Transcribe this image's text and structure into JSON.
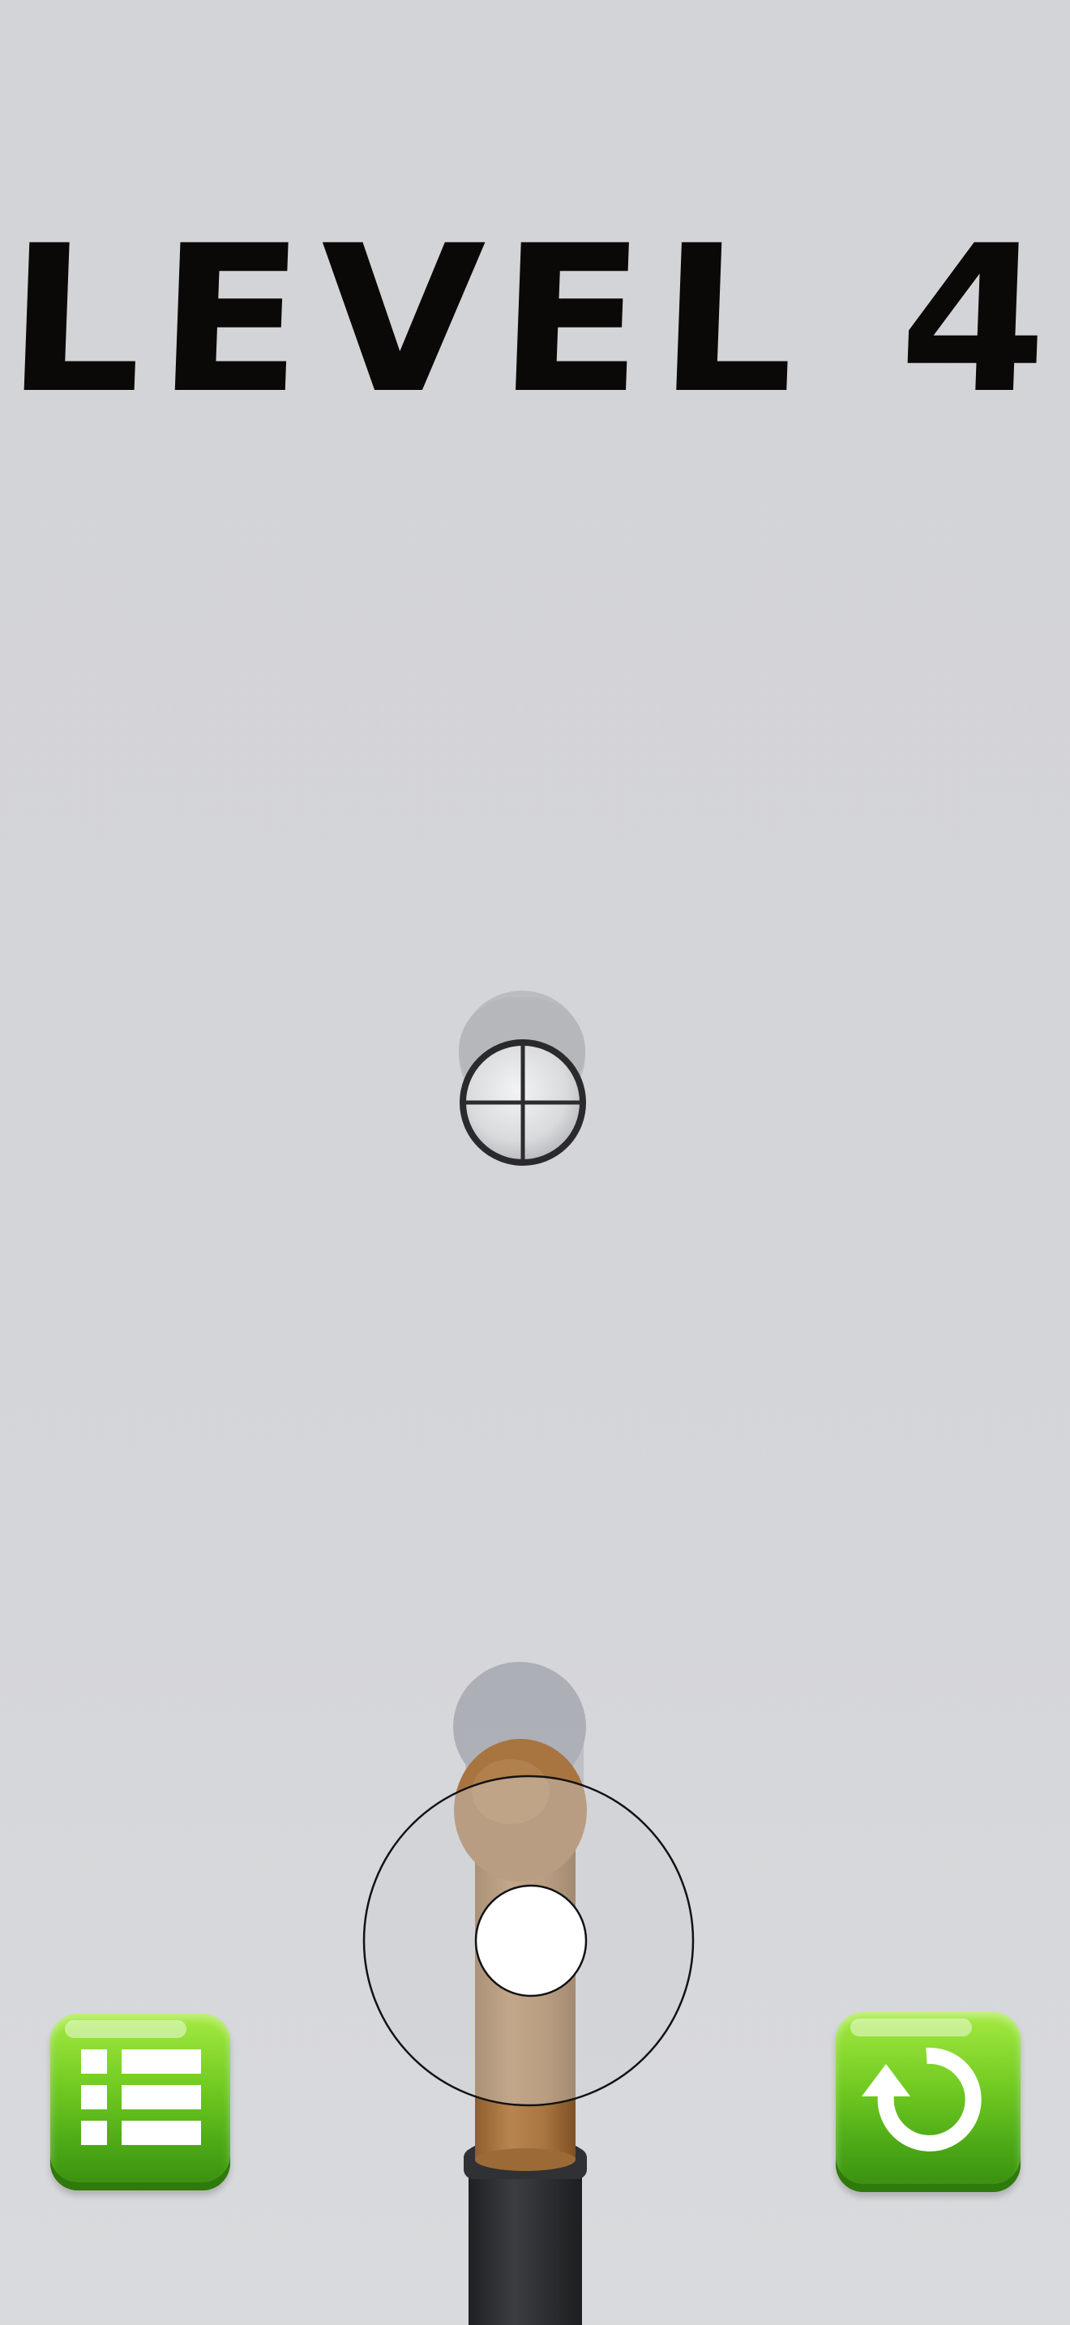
{
  "hud": {
    "level_label": "LEVEL 4"
  },
  "colors": {
    "background": "#d3d4d7",
    "title": "#0b0907",
    "button_green": "#5bbb1a",
    "pipe_brown": "#ad7a43",
    "base_dark": "#2f3032"
  },
  "icons": {
    "menu_button": "list-icon",
    "restart_button": "restart-arrow-icon",
    "target": "crosshair-icon",
    "joystick": "joystick-icon"
  }
}
